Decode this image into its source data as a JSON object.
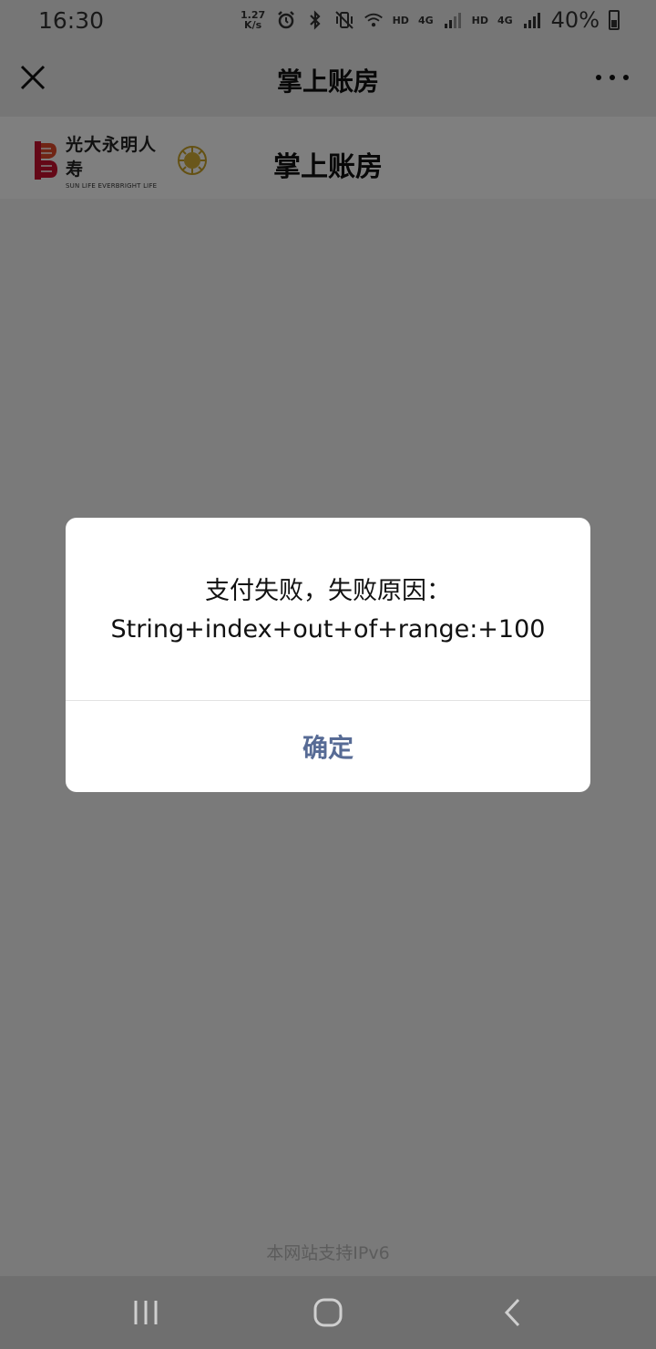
{
  "status_bar": {
    "time": "16:30",
    "network_speed_value": "1.27",
    "network_speed_unit": "K/s",
    "hd_1": "HD",
    "hd_2": "HD",
    "net_1": "4G",
    "net_2": "4G",
    "battery_percent": "40%",
    "icons": [
      "alarm-icon",
      "bluetooth-icon",
      "vibrate-icon",
      "wifi-icon",
      "signal-icon",
      "battery-icon"
    ]
  },
  "nav_bar": {
    "title": "掌上账房",
    "icons": [
      "close-icon",
      "more-icon"
    ]
  },
  "header": {
    "brand_cn": "光大永明人寿",
    "brand_en": "SUN LIFE EVERBRIGHT LIFE",
    "title": "掌上账房"
  },
  "dialog": {
    "line1": "支付失败，失败原因：",
    "line2": "String+index+out+of+range:+100",
    "confirm_label": "确定",
    "accent_color": "#576b95"
  },
  "footer": {
    "note": "本网站支持IPv6"
  },
  "system_nav": {
    "icons": [
      "recent-apps-icon",
      "home-icon",
      "back-icon"
    ]
  }
}
